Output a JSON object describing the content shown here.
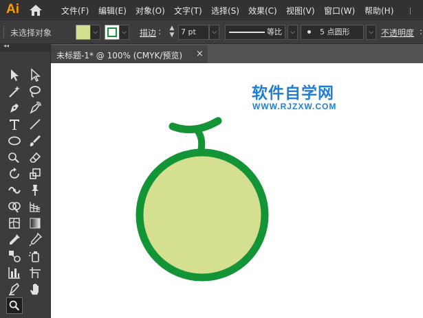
{
  "app": {
    "logo": "Ai",
    "home_icon": "home-icon"
  },
  "menu": [
    "文件(F)",
    "编辑(E)",
    "对象(O)",
    "文字(T)",
    "选择(S)",
    "效果(C)",
    "视图(V)",
    "窗口(W)",
    "帮助(H)"
  ],
  "control_bar": {
    "selection_status": "未选择对象",
    "stroke_label": "描边",
    "stroke_weight": "7 pt",
    "profile_label": "等比",
    "brush_label": "5 点圆形",
    "opacity_label": "不透明度"
  },
  "document": {
    "tab_title": "未标题-1* @ 100% (CMYK/预览)",
    "close": "×"
  },
  "toolbar": {
    "collapse": "◂◂"
  },
  "watermark": {
    "title": "软件自学网",
    "url": "WWW.RJZXW.COM"
  },
  "colors": {
    "fill": "#d4df8f",
    "stroke": "#139436",
    "watermark": "#1d7fd8"
  }
}
